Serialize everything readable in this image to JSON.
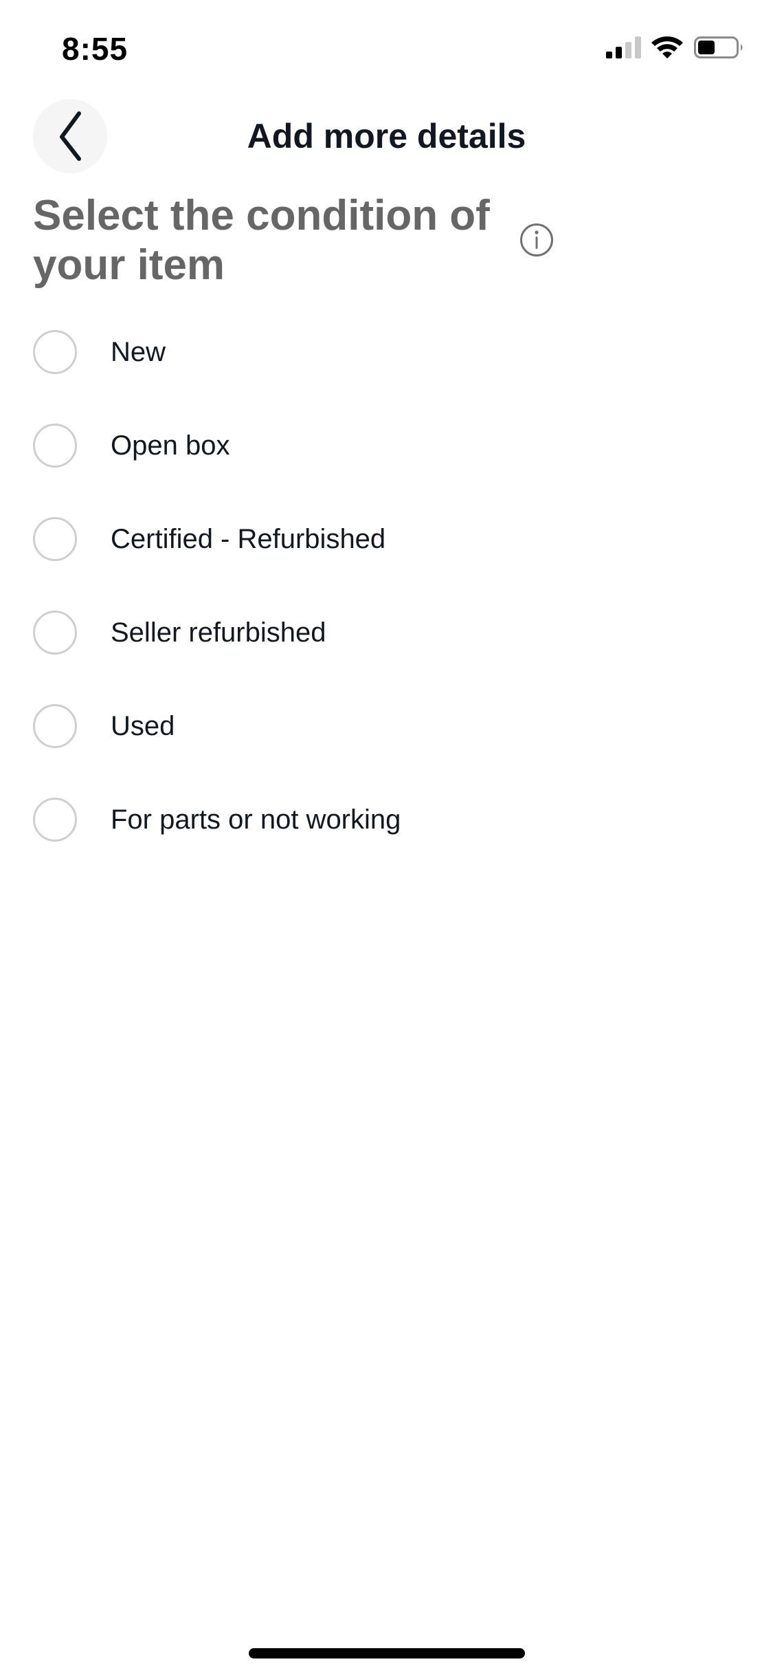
{
  "status_bar": {
    "time": "8:55",
    "signal_bars_total": 4,
    "signal_bars_active": 2,
    "wifi_icon": "wifi-icon",
    "battery_level_fraction": 0.45
  },
  "header": {
    "back_icon": "chevron-left-icon",
    "title": "Add more details"
  },
  "main": {
    "heading": "Select the condition of your item",
    "info_icon": "info-circle-icon",
    "conditions": [
      {
        "label": "New",
        "selected": false
      },
      {
        "label": "Open box",
        "selected": false
      },
      {
        "label": "Certified - Refurbished",
        "selected": false
      },
      {
        "label": "Seller refurbished",
        "selected": false
      },
      {
        "label": "Used",
        "selected": false
      },
      {
        "label": "For parts or not working",
        "selected": false
      }
    ]
  },
  "colors": {
    "text_primary": "#111820",
    "heading_gray": "#666666",
    "radio_border": "#cfcfcf",
    "back_button_bg": "#f5f5f5"
  }
}
